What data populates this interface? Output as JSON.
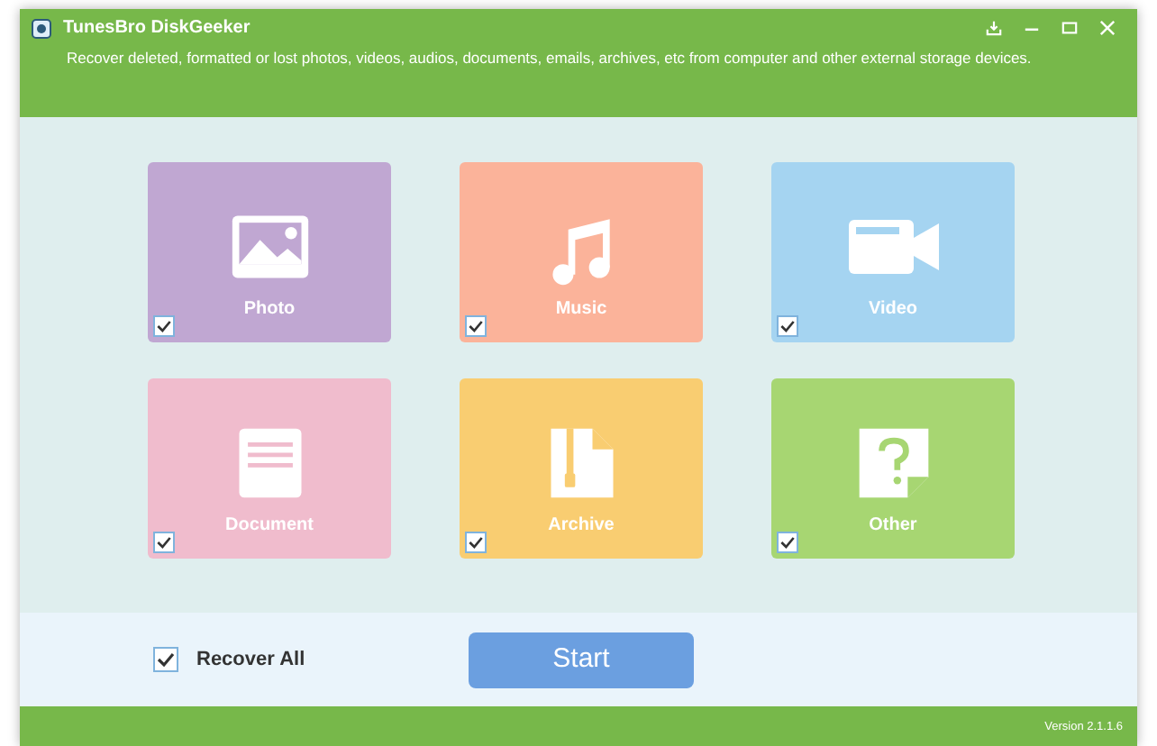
{
  "window": {
    "title": "TunesBro DiskGeeker",
    "subtitle": "Recover deleted, formatted or lost photos, videos, audios, documents, emails, archives, etc from computer and other external storage devices."
  },
  "categories": [
    {
      "kind": "photo",
      "label": "Photo",
      "checked": true,
      "color": "#c0a7d2"
    },
    {
      "kind": "music",
      "label": "Music",
      "checked": true,
      "color": "#fbb39a"
    },
    {
      "kind": "video",
      "label": "Video",
      "checked": true,
      "color": "#a5d4f1"
    },
    {
      "kind": "document",
      "label": "Document",
      "checked": true,
      "color": "#f0bccd"
    },
    {
      "kind": "archive",
      "label": "Archive",
      "checked": true,
      "color": "#f9cd71"
    },
    {
      "kind": "other",
      "label": "Other",
      "checked": true,
      "color": "#a7d672"
    }
  ],
  "recover_all": {
    "label": "Recover All",
    "checked": true
  },
  "start_button": "Start",
  "version": "Version 2.1.1.6"
}
